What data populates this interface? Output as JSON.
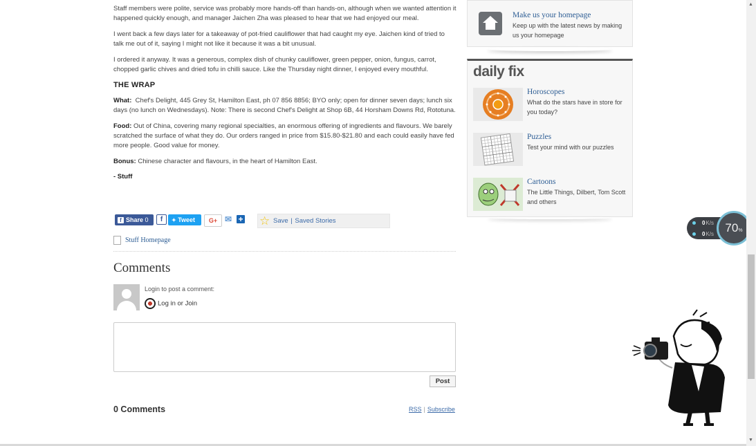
{
  "article": {
    "p1": "Staff members were polite, service was probably more hands-off than hands-on, although when we wanted attention it happened quickly enough, and manager Jaichen Zha was pleased to hear that we had enjoyed our meal.",
    "p2": "I went back a few days later for a takeaway of pot-fried cauliflower that had caught my eye. Jaichen kind of tried to talk me out of it, saying I might not like it because it was a bit unusual.",
    "p3": "I ordered it anyway. It was a generous, complex dish of chunky cauliflower, green pepper, onion, fungus, carrot, chopped garlic chives and dried tofu in chilli sauce. Like the Thursday night dinner, I enjoyed every mouthful.",
    "wrap_heading": "THE WRAP",
    "what_label": "What:",
    "what_text": "Chef's Delight, 445 Grey St, Hamilton East, ph 07 856 8856; BYO only; open for dinner seven days; lunch six days (no lunch on Wednesdays). Note: There is second Chef's Delight at Shop 6B, 44 Horsham Downs Rd, Rototuna.",
    "food_label": "Food:",
    "food_text": "Out of China, covering many regional specialties, an enormous offering of ingredients and flavours. We barely scratched the surface of what they do. Our orders ranged in price from $15.80-$21.80 and each could easily have fed more people. Good value for money.",
    "bonus_label": "Bonus:",
    "bonus_text": "Chinese character and flavours, in the heart of Hamilton East.",
    "byline": "- Stuff"
  },
  "share": {
    "fb_share_label": "Share",
    "fb_share_count": "0",
    "fb_icon": "f",
    "tweet_label": "Tweet",
    "gplus_label": "G+",
    "save_label": "Save",
    "saved_stories_label": "Saved Stories",
    "separator": "|"
  },
  "home_link": "Stuff Homepage",
  "comments": {
    "heading": "Comments",
    "login_prompt": "Login to post a comment:",
    "login_link": "Log in or Join",
    "post_button": "Post",
    "count_heading": "0 Comments",
    "rss": "RSS",
    "subscribe": "Subscribe"
  },
  "sidebar": {
    "promo_title": "Make us your homepage",
    "promo_desc": "Keep up with the latest news by making us your homepage",
    "daily_heading": "daily fix",
    "items": [
      {
        "title": "Horoscopes",
        "desc": "What do the stars have in store for you today?",
        "icon": "horoscope-wheel"
      },
      {
        "title": "Puzzles",
        "desc": "Test your mind with our puzzles",
        "icon": "sudoku-grid"
      },
      {
        "title": "Cartoons",
        "desc": "The Little Things, Dilbert, Tom Scott and others",
        "icon": "cartoon-thumb"
      }
    ]
  },
  "speed_widget": {
    "up": "0",
    "down": "0",
    "unit": "K/s",
    "percent": "70",
    "percent_sign": "%"
  },
  "colors": {
    "link": "#2d5d94",
    "facebook": "#3b5998",
    "twitter": "#1da1f2",
    "daily_border": "#555555"
  }
}
